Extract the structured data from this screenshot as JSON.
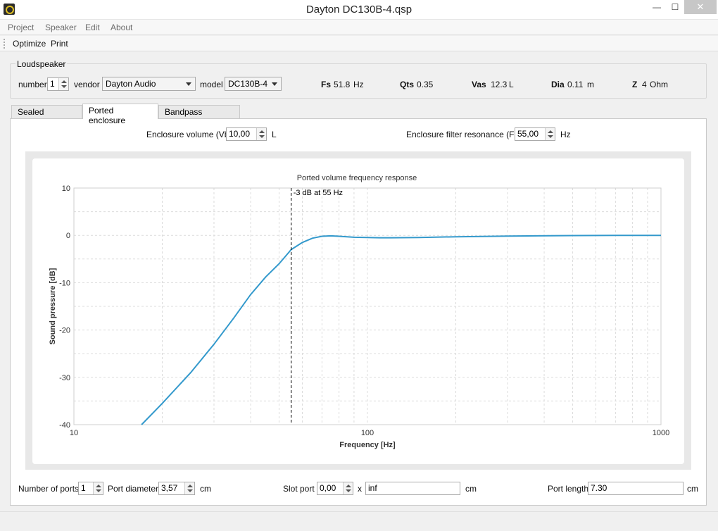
{
  "window": {
    "title": "Dayton DC130B-4.qsp",
    "minimize": "—",
    "maximize": "☐",
    "close": "✕"
  },
  "menu": [
    "Project",
    "Speaker",
    "Edit",
    "About"
  ],
  "toolbar": {
    "optimize": "Optimize",
    "print": "Print"
  },
  "loudspeaker": {
    "title": "Loudspeaker",
    "number_label": "number",
    "number_value": "1",
    "vendor_label": "vendor",
    "vendor_value": "Dayton Audio",
    "model_label": "model",
    "model_value": "DC130B-4",
    "fs_label": "Fs",
    "fs_value": "51.8",
    "fs_unit": "Hz",
    "qts_label": "Qts",
    "qts_value": "0.35",
    "vas_label": "Vas",
    "vas_value": "12.3",
    "vas_unit": "L",
    "dia_label": "Dia",
    "dia_value": "0.11",
    "dia_unit": "m",
    "z_label": "Z",
    "z_value": "4",
    "z_unit": "Ohm"
  },
  "tabs": [
    "Sealed enclosure",
    "Ported enclosure",
    "Bandpass enclosure"
  ],
  "active_tab": "Ported enclosure",
  "enclosure": {
    "vb_label": "Enclosure volume (Vb)",
    "vb_value": "10,00",
    "vb_unit": "L",
    "fb_label": "Enclosure filter resonance (Fb)",
    "fb_value": "55,00",
    "fb_unit": "Hz"
  },
  "ports": {
    "count_label": "Number of ports",
    "count_value": "1",
    "diameter_label": "Port diameter",
    "diameter_value": "3,57",
    "diameter_unit": "cm",
    "slot_label": "Slot port",
    "slot_value": "0,00",
    "slot_x": "x",
    "slot_inf": "inf",
    "slot_unit": "cm",
    "length_label": "Port length",
    "length_value": "7.30",
    "length_unit": "cm"
  },
  "chart_data": {
    "type": "line",
    "title": "Ported volume frequency response",
    "xlabel": "Frequency [Hz]",
    "ylabel": "Sound pressure [dB]",
    "xscale": "log",
    "xlim": [
      10,
      1000
    ],
    "ylim": [
      -40,
      10
    ],
    "xticks": [
      "10",
      "100",
      "1000"
    ],
    "yticks": [
      "10",
      "0",
      "-10",
      "-20",
      "-30",
      "-40"
    ],
    "grid": true,
    "line_color": "#3399cc",
    "annotation": {
      "x": 55,
      "label": "-3 dB at 55 Hz"
    },
    "series": [
      {
        "x": [
          17,
          20,
          25,
          30,
          35,
          40,
          45,
          50,
          55,
          60,
          65,
          70,
          75,
          80,
          90,
          100,
          110,
          120,
          150,
          200,
          300,
          500,
          700,
          1000
        ],
        "y": [
          -40,
          -35.5,
          -29.0,
          -23.0,
          -17.5,
          -12.5,
          -8.8,
          -6.0,
          -3.0,
          -1.5,
          -0.6,
          -0.2,
          -0.1,
          -0.2,
          -0.4,
          -0.45,
          -0.5,
          -0.5,
          -0.45,
          -0.3,
          -0.15,
          -0.05,
          0,
          0
        ]
      }
    ]
  }
}
